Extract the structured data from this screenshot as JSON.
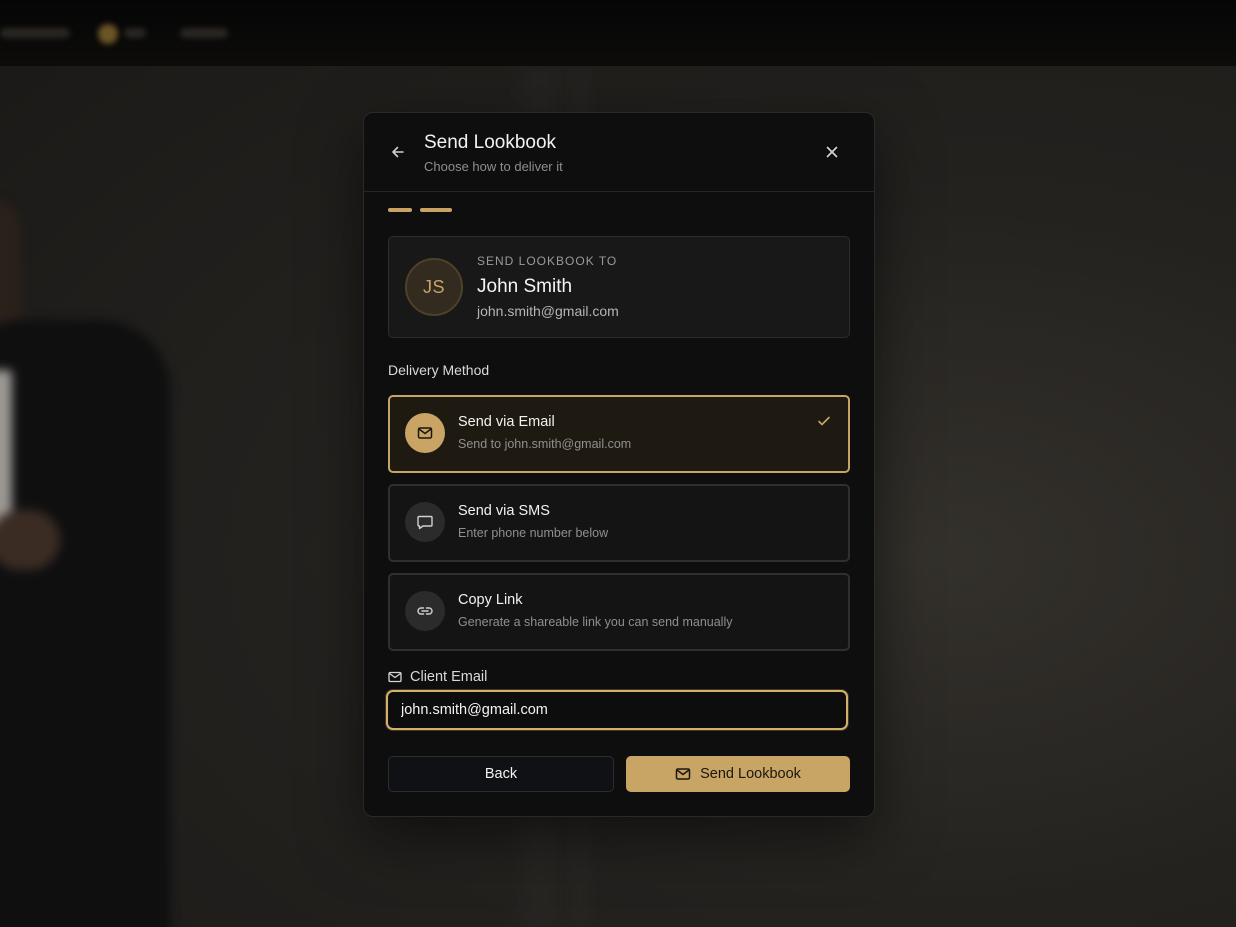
{
  "modal": {
    "title": "Send Lookbook",
    "subtitle": "Choose how to deliver it"
  },
  "recipient": {
    "label": "SEND LOOKBOOK TO",
    "initials": "JS",
    "name": "John Smith",
    "email": "john.smith@gmail.com"
  },
  "delivery": {
    "section_label": "Delivery Method",
    "options": [
      {
        "title": "Send via Email",
        "description": "Send to john.smith@gmail.com",
        "icon": "mail-icon",
        "selected": true
      },
      {
        "title": "Send via SMS",
        "description": "Enter phone number below",
        "icon": "message-icon",
        "selected": false
      },
      {
        "title": "Copy Link",
        "description": "Generate a shareable link you can send manually",
        "icon": "link-icon",
        "selected": false
      }
    ]
  },
  "client_email": {
    "label": "Client Email",
    "value": "john.smith@gmail.com"
  },
  "actions": {
    "back_label": "Back",
    "send_label": "Send Lookbook"
  },
  "colors": {
    "accent": "#c8a465",
    "modal_bg": "#0e0e0e",
    "card_bg": "#181818"
  }
}
